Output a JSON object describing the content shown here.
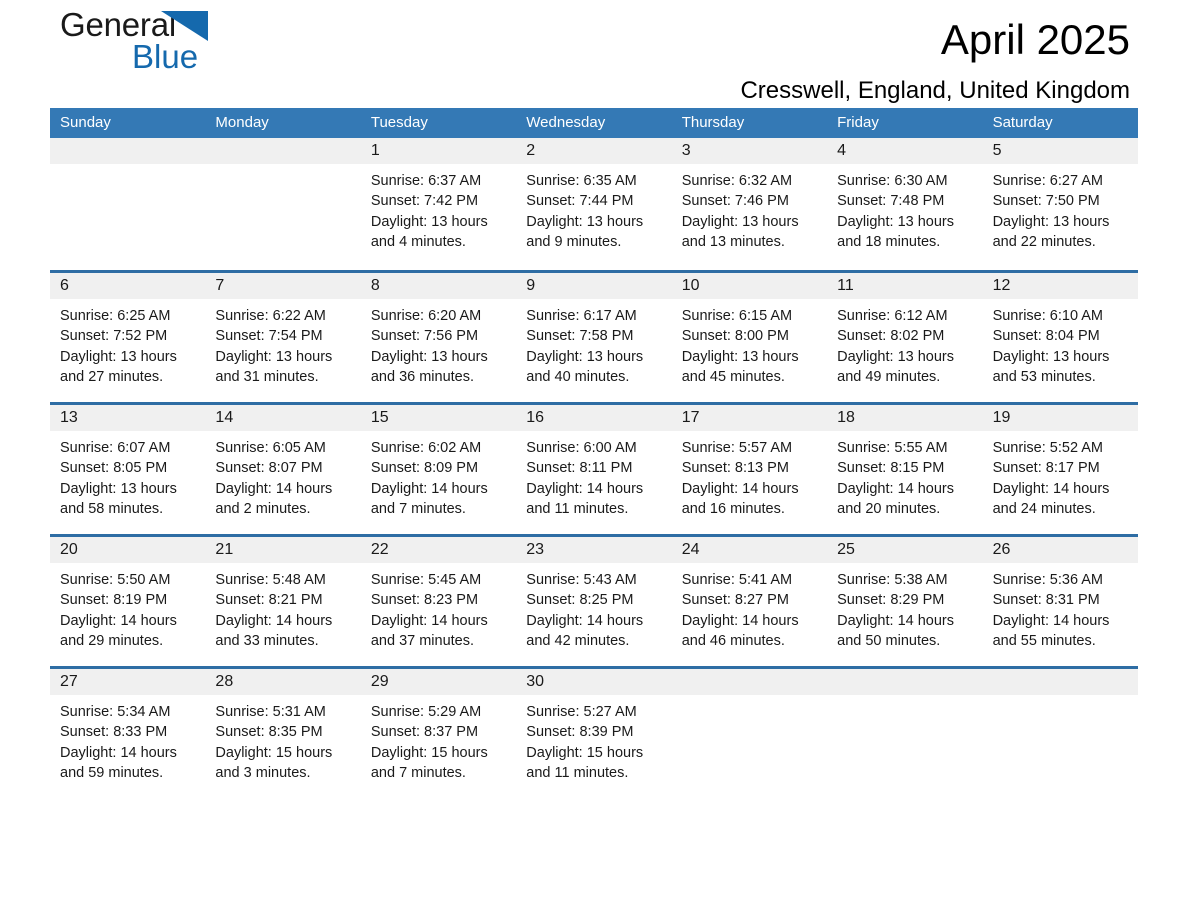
{
  "brand": {
    "name_part1": "General",
    "name_part2": "Blue",
    "logo_icon": "triangle-icon",
    "accent_color": "#1569ad"
  },
  "header": {
    "title": "April 2025",
    "subtitle": "Cresswell, England, United Kingdom"
  },
  "colors": {
    "header_row_bg": "#3479b5",
    "week_divider": "#2e6da4",
    "day_number_band": "#f0f0f0",
    "text": "#1a1a1a"
  },
  "weekdays": [
    "Sunday",
    "Monday",
    "Tuesday",
    "Wednesday",
    "Thursday",
    "Friday",
    "Saturday"
  ],
  "weeks": [
    [
      {
        "day": "",
        "sunrise": "",
        "sunset": "",
        "daylight": "",
        "daylight2": ""
      },
      {
        "day": "",
        "sunrise": "",
        "sunset": "",
        "daylight": "",
        "daylight2": ""
      },
      {
        "day": "1",
        "sunrise": "Sunrise: 6:37 AM",
        "sunset": "Sunset: 7:42 PM",
        "daylight": "Daylight: 13 hours",
        "daylight2": "and 4 minutes."
      },
      {
        "day": "2",
        "sunrise": "Sunrise: 6:35 AM",
        "sunset": "Sunset: 7:44 PM",
        "daylight": "Daylight: 13 hours",
        "daylight2": "and 9 minutes."
      },
      {
        "day": "3",
        "sunrise": "Sunrise: 6:32 AM",
        "sunset": "Sunset: 7:46 PM",
        "daylight": "Daylight: 13 hours",
        "daylight2": "and 13 minutes."
      },
      {
        "day": "4",
        "sunrise": "Sunrise: 6:30 AM",
        "sunset": "Sunset: 7:48 PM",
        "daylight": "Daylight: 13 hours",
        "daylight2": "and 18 minutes."
      },
      {
        "day": "5",
        "sunrise": "Sunrise: 6:27 AM",
        "sunset": "Sunset: 7:50 PM",
        "daylight": "Daylight: 13 hours",
        "daylight2": "and 22 minutes."
      }
    ],
    [
      {
        "day": "6",
        "sunrise": "Sunrise: 6:25 AM",
        "sunset": "Sunset: 7:52 PM",
        "daylight": "Daylight: 13 hours",
        "daylight2": "and 27 minutes."
      },
      {
        "day": "7",
        "sunrise": "Sunrise: 6:22 AM",
        "sunset": "Sunset: 7:54 PM",
        "daylight": "Daylight: 13 hours",
        "daylight2": "and 31 minutes."
      },
      {
        "day": "8",
        "sunrise": "Sunrise: 6:20 AM",
        "sunset": "Sunset: 7:56 PM",
        "daylight": "Daylight: 13 hours",
        "daylight2": "and 36 minutes."
      },
      {
        "day": "9",
        "sunrise": "Sunrise: 6:17 AM",
        "sunset": "Sunset: 7:58 PM",
        "daylight": "Daylight: 13 hours",
        "daylight2": "and 40 minutes."
      },
      {
        "day": "10",
        "sunrise": "Sunrise: 6:15 AM",
        "sunset": "Sunset: 8:00 PM",
        "daylight": "Daylight: 13 hours",
        "daylight2": "and 45 minutes."
      },
      {
        "day": "11",
        "sunrise": "Sunrise: 6:12 AM",
        "sunset": "Sunset: 8:02 PM",
        "daylight": "Daylight: 13 hours",
        "daylight2": "and 49 minutes."
      },
      {
        "day": "12",
        "sunrise": "Sunrise: 6:10 AM",
        "sunset": "Sunset: 8:04 PM",
        "daylight": "Daylight: 13 hours",
        "daylight2": "and 53 minutes."
      }
    ],
    [
      {
        "day": "13",
        "sunrise": "Sunrise: 6:07 AM",
        "sunset": "Sunset: 8:05 PM",
        "daylight": "Daylight: 13 hours",
        "daylight2": "and 58 minutes."
      },
      {
        "day": "14",
        "sunrise": "Sunrise: 6:05 AM",
        "sunset": "Sunset: 8:07 PM",
        "daylight": "Daylight: 14 hours",
        "daylight2": "and 2 minutes."
      },
      {
        "day": "15",
        "sunrise": "Sunrise: 6:02 AM",
        "sunset": "Sunset: 8:09 PM",
        "daylight": "Daylight: 14 hours",
        "daylight2": "and 7 minutes."
      },
      {
        "day": "16",
        "sunrise": "Sunrise: 6:00 AM",
        "sunset": "Sunset: 8:11 PM",
        "daylight": "Daylight: 14 hours",
        "daylight2": "and 11 minutes."
      },
      {
        "day": "17",
        "sunrise": "Sunrise: 5:57 AM",
        "sunset": "Sunset: 8:13 PM",
        "daylight": "Daylight: 14 hours",
        "daylight2": "and 16 minutes."
      },
      {
        "day": "18",
        "sunrise": "Sunrise: 5:55 AM",
        "sunset": "Sunset: 8:15 PM",
        "daylight": "Daylight: 14 hours",
        "daylight2": "and 20 minutes."
      },
      {
        "day": "19",
        "sunrise": "Sunrise: 5:52 AM",
        "sunset": "Sunset: 8:17 PM",
        "daylight": "Daylight: 14 hours",
        "daylight2": "and 24 minutes."
      }
    ],
    [
      {
        "day": "20",
        "sunrise": "Sunrise: 5:50 AM",
        "sunset": "Sunset: 8:19 PM",
        "daylight": "Daylight: 14 hours",
        "daylight2": "and 29 minutes."
      },
      {
        "day": "21",
        "sunrise": "Sunrise: 5:48 AM",
        "sunset": "Sunset: 8:21 PM",
        "daylight": "Daylight: 14 hours",
        "daylight2": "and 33 minutes."
      },
      {
        "day": "22",
        "sunrise": "Sunrise: 5:45 AM",
        "sunset": "Sunset: 8:23 PM",
        "daylight": "Daylight: 14 hours",
        "daylight2": "and 37 minutes."
      },
      {
        "day": "23",
        "sunrise": "Sunrise: 5:43 AM",
        "sunset": "Sunset: 8:25 PM",
        "daylight": "Daylight: 14 hours",
        "daylight2": "and 42 minutes."
      },
      {
        "day": "24",
        "sunrise": "Sunrise: 5:41 AM",
        "sunset": "Sunset: 8:27 PM",
        "daylight": "Daylight: 14 hours",
        "daylight2": "and 46 minutes."
      },
      {
        "day": "25",
        "sunrise": "Sunrise: 5:38 AM",
        "sunset": "Sunset: 8:29 PM",
        "daylight": "Daylight: 14 hours",
        "daylight2": "and 50 minutes."
      },
      {
        "day": "26",
        "sunrise": "Sunrise: 5:36 AM",
        "sunset": "Sunset: 8:31 PM",
        "daylight": "Daylight: 14 hours",
        "daylight2": "and 55 minutes."
      }
    ],
    [
      {
        "day": "27",
        "sunrise": "Sunrise: 5:34 AM",
        "sunset": "Sunset: 8:33 PM",
        "daylight": "Daylight: 14 hours",
        "daylight2": "and 59 minutes."
      },
      {
        "day": "28",
        "sunrise": "Sunrise: 5:31 AM",
        "sunset": "Sunset: 8:35 PM",
        "daylight": "Daylight: 15 hours",
        "daylight2": "and 3 minutes."
      },
      {
        "day": "29",
        "sunrise": "Sunrise: 5:29 AM",
        "sunset": "Sunset: 8:37 PM",
        "daylight": "Daylight: 15 hours",
        "daylight2": "and 7 minutes."
      },
      {
        "day": "30",
        "sunrise": "Sunrise: 5:27 AM",
        "sunset": "Sunset: 8:39 PM",
        "daylight": "Daylight: 15 hours",
        "daylight2": "and 11 minutes."
      },
      {
        "day": "",
        "sunrise": "",
        "sunset": "",
        "daylight": "",
        "daylight2": ""
      },
      {
        "day": "",
        "sunrise": "",
        "sunset": "",
        "daylight": "",
        "daylight2": ""
      },
      {
        "day": "",
        "sunrise": "",
        "sunset": "",
        "daylight": "",
        "daylight2": ""
      }
    ]
  ]
}
